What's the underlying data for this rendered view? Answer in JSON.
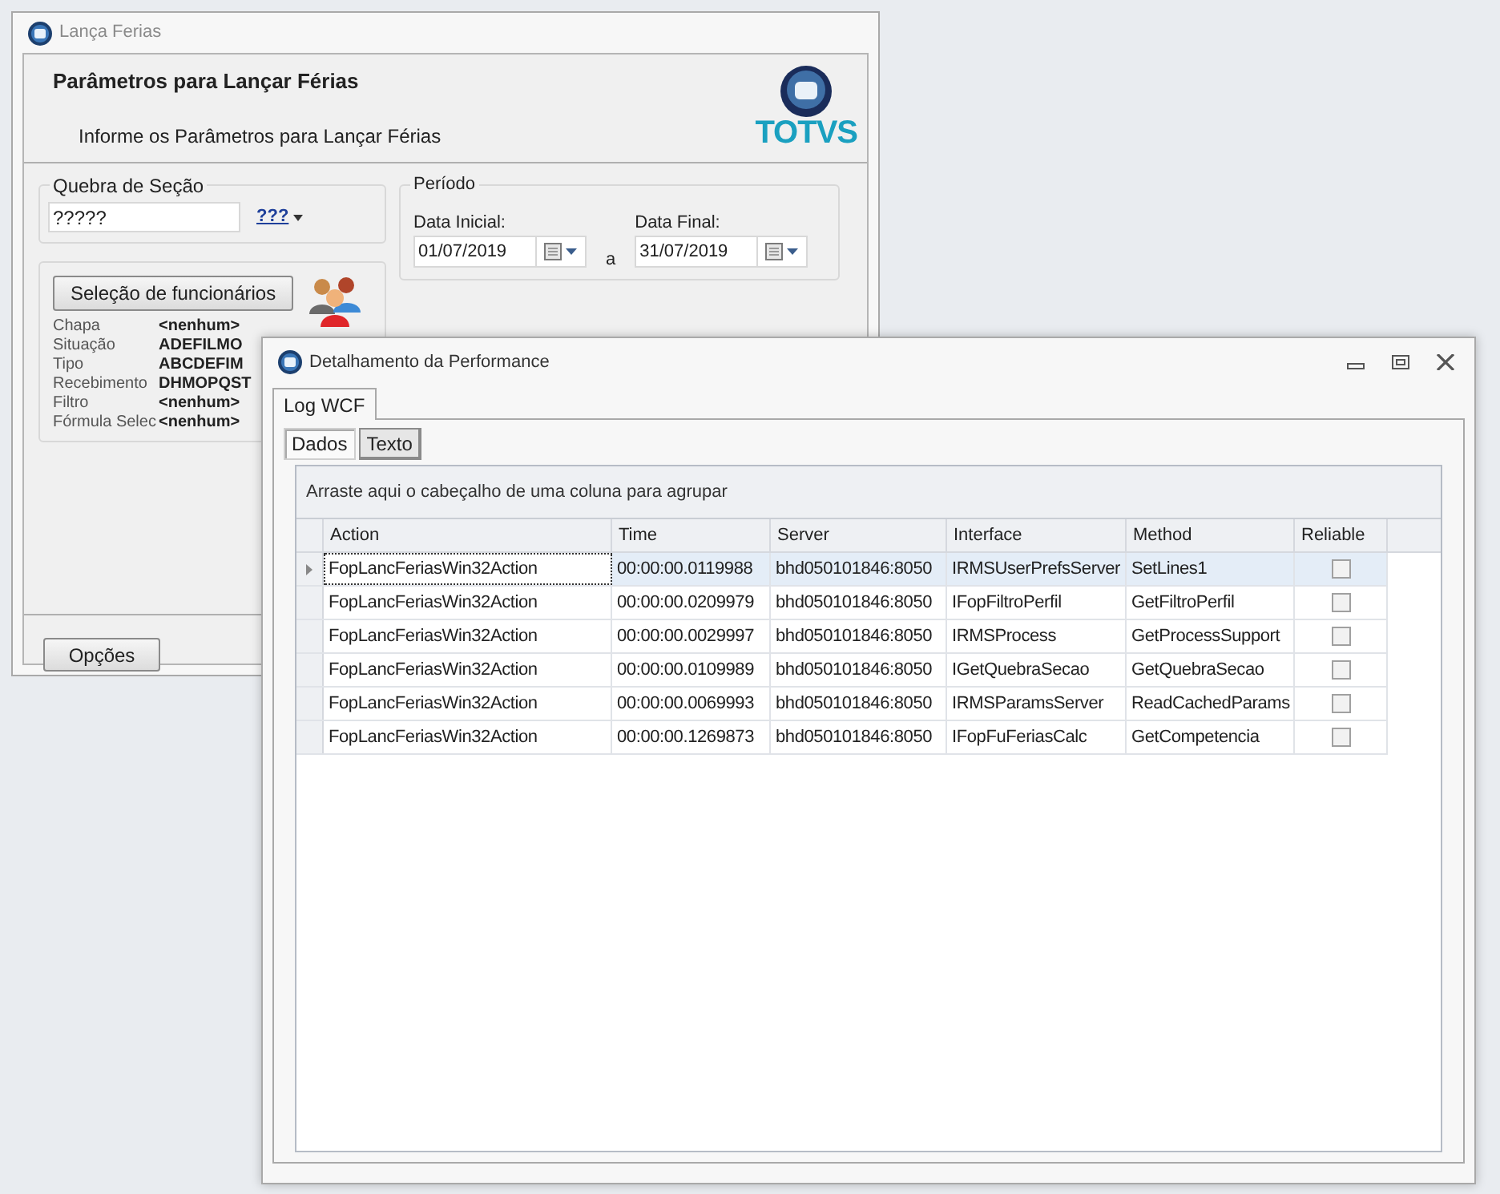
{
  "back_window": {
    "title": "Lança Ferias",
    "header": {
      "title": "Parâmetros para Lançar Férias",
      "subtitle": "Informe os Parâmetros para Lançar Férias",
      "logo_text": "TOTVS"
    },
    "quebra": {
      "legend": "Quebra de Seção",
      "value": "?????",
      "button": "???"
    },
    "periodo": {
      "legend": "Período",
      "start_label": "Data Inicial:",
      "start": "01/07/2019",
      "separator": "a",
      "end_label": "Data Final:",
      "end": "31/07/2019"
    },
    "selecao": {
      "button": "Seleção de funcionários",
      "fields": [
        {
          "label": "Chapa",
          "value": "<nenhum>"
        },
        {
          "label": "Situação",
          "value": "ADEFILMO"
        },
        {
          "label": "Tipo",
          "value": "ABCDEFIM"
        },
        {
          "label": "Recebimento",
          "value": "DHMOPQST"
        },
        {
          "label": "Filtro",
          "value": "<nenhum>"
        },
        {
          "label": "Fórmula Selec",
          "value": "<nenhum>"
        }
      ]
    },
    "options_button": "Opções"
  },
  "front_window": {
    "title": "Detalhamento da Performance",
    "tabs": [
      {
        "label": "Log WCF",
        "selected": true
      }
    ],
    "subtabs": [
      {
        "label": "Dados",
        "selected": true
      },
      {
        "label": "Texto",
        "selected": false
      }
    ],
    "grid": {
      "group_hint": "Arraste aqui o cabeçalho de uma coluna para agrupar",
      "columns": [
        "Action",
        "Time",
        "Server",
        "Interface",
        "Method",
        "Reliable"
      ],
      "rows": [
        {
          "selected": true,
          "cells": [
            "FopLancFeriasWin32Action",
            "00:00:00.0119988",
            "bhd050101846:8050",
            "IRMSUserPrefsServer",
            "SetLines1"
          ],
          "reliable": false
        },
        {
          "selected": false,
          "cells": [
            "FopLancFeriasWin32Action",
            "00:00:00.0209979",
            "bhd050101846:8050",
            "IFopFiltroPerfil",
            "GetFiltroPerfil"
          ],
          "reliable": false
        },
        {
          "selected": false,
          "cells": [
            "FopLancFeriasWin32Action",
            "00:00:00.0029997",
            "bhd050101846:8050",
            "IRMSProcess",
            "GetProcessSupport"
          ],
          "reliable": false
        },
        {
          "selected": false,
          "cells": [
            "FopLancFeriasWin32Action",
            "00:00:00.0109989",
            "bhd050101846:8050",
            "IGetQuebraSecao",
            "GetQuebraSecao"
          ],
          "reliable": false
        },
        {
          "selected": false,
          "cells": [
            "FopLancFeriasWin32Action",
            "00:00:00.0069993",
            "bhd050101846:8050",
            "IRMSParamsServer",
            "ReadCachedParams"
          ],
          "reliable": false
        },
        {
          "selected": false,
          "cells": [
            "FopLancFeriasWin32Action",
            "00:00:00.1269873",
            "bhd050101846:8050",
            "IFopFuFeriasCalc",
            "GetCompetencia"
          ],
          "reliable": false
        }
      ]
    }
  }
}
